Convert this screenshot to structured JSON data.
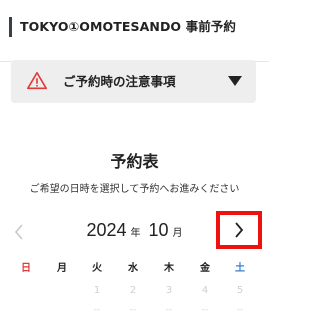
{
  "header": {
    "title": "TOKYO①OMOTESANDO 事前予約"
  },
  "notice": {
    "label": "ご予約時の注意事項",
    "icon": "warning-icon",
    "accent": "#e03a3a"
  },
  "schedule": {
    "title": "予約表",
    "subtitle": "ご希望の日時を選択して予約へお進みください",
    "year": "2024",
    "year_unit": "年",
    "month": "10",
    "month_unit": "月",
    "prev_icon": "chevron-left-icon",
    "next_icon": "chevron-right-icon",
    "weekdays": [
      "日",
      "月",
      "火",
      "水",
      "木",
      "金",
      "土"
    ],
    "days": [
      "1",
      "2",
      "3",
      "4",
      "5"
    ],
    "day_marks": [
      "--",
      "--",
      "--",
      "--",
      "--"
    ],
    "highlight_color": "#ef1010"
  }
}
